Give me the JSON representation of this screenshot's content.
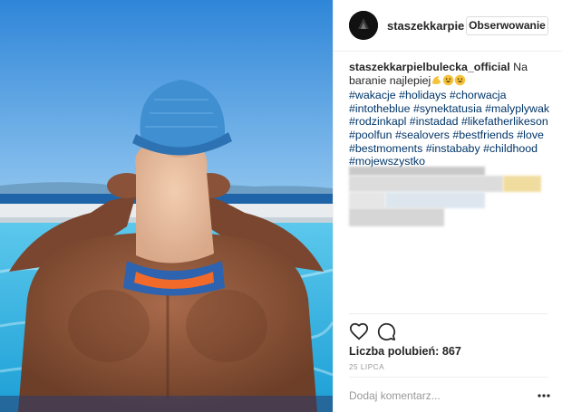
{
  "post": {
    "photo_alt": "",
    "author": {
      "username": "staszekkarpie",
      "follow_label": "Obserwowanie"
    },
    "caption": {
      "username": "staszekkarpielbulecka_official",
      "text": "Na baranie najlepiej",
      "emojis": [
        "flexed-biceps",
        "grinning-face",
        "grinning-face"
      ],
      "hashtags": "#wakacje #holidays #chorwacja #intotheblue #synektatusia #malyplywak #rodzinkapl #instadad #likefatherlikeson #poolfun #sealovers #bestfriends #love #bestmoments #instababy #childhood #mojewszystko"
    },
    "icons": {
      "like": "heart-icon",
      "comment": "comment-bubble-icon",
      "more": "more-options-icon"
    },
    "likes_text": "Liczba polubień: 867",
    "date_text": "25 LIPCA",
    "comment_placeholder": "Dodaj komentarz...",
    "colors": {
      "hashtag": "#003569",
      "border": "#efefef",
      "secondary_text": "#999999"
    }
  }
}
